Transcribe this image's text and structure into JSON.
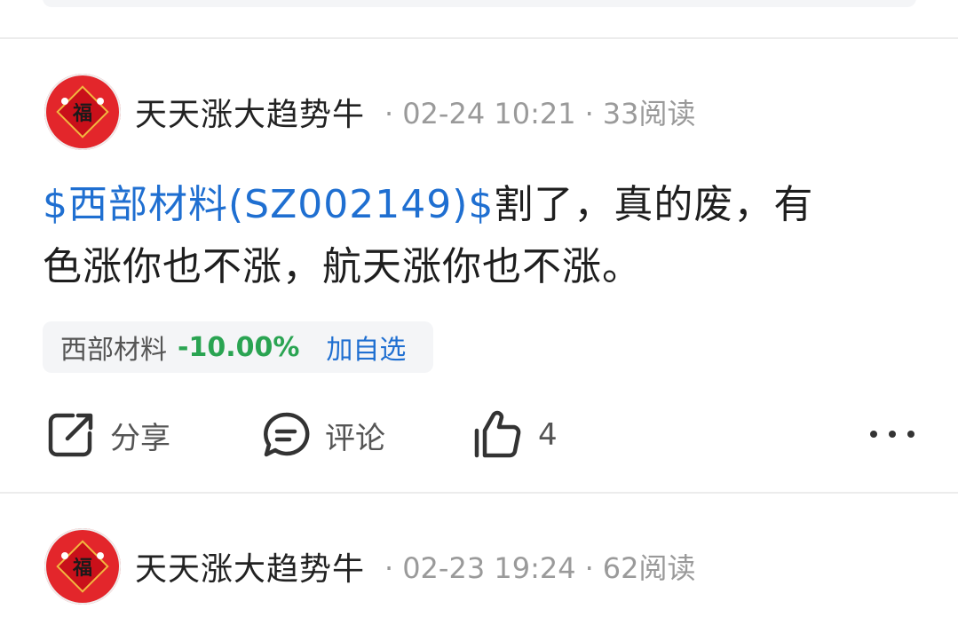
{
  "posts": [
    {
      "username": "天天涨大趋势牛",
      "date": "02-24 10:21",
      "reads": "33阅读",
      "avatar_char": "福",
      "body": {
        "stock_link": "$西部材料(SZ002149)$",
        "text_line1": "割了，真的废，有",
        "text_line2": "色涨你也不涨，航天涨你也不涨。"
      },
      "stock_chip": {
        "name": "西部材料",
        "change": "-10.00%",
        "add_label": "加自选"
      },
      "actions": {
        "share_label": "分享",
        "comment_label": "评论",
        "like_count": "4"
      }
    },
    {
      "username": "天天涨大趋势牛",
      "date": "02-23 19:24",
      "reads": "62阅读",
      "avatar_char": "福"
    }
  ],
  "meta_separator": "·",
  "icons": {
    "share": "share-icon",
    "comment": "comment-icon",
    "like": "thumbs-up-icon",
    "more": "more-dots-icon"
  },
  "colors": {
    "link": "#1f6fd1",
    "down": "#2aa452",
    "avatar": "#e3262b"
  }
}
